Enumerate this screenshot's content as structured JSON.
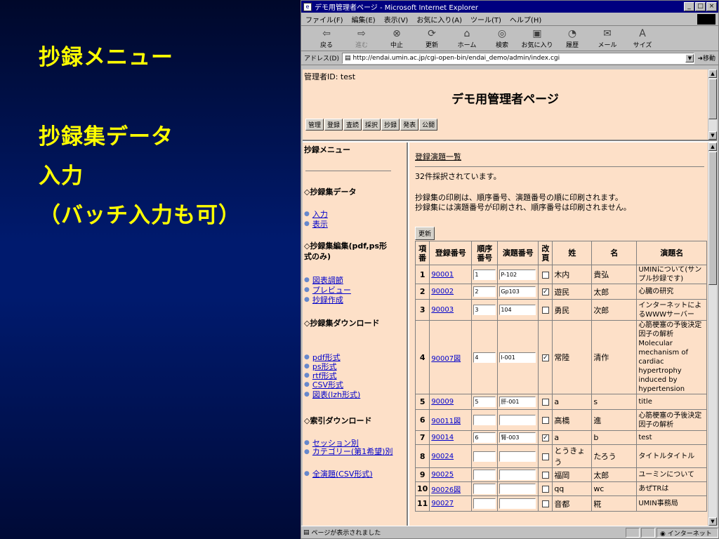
{
  "slide": {
    "heading": "抄録メニュー",
    "lines": [
      "抄録集データ",
      "入力",
      "（バッチ入力も可）"
    ]
  },
  "window": {
    "title": "デモ用管理者ページ - Microsoft Internet Explorer",
    "menu": [
      "ファイル(F)",
      "編集(E)",
      "表示(V)",
      "お気に入り(A)",
      "ツール(T)",
      "ヘルプ(H)"
    ],
    "toolbar": [
      {
        "label": "戻る",
        "icon": "back-arrow"
      },
      {
        "label": "進む",
        "icon": "forward-arrow"
      },
      {
        "label": "中止",
        "icon": "stop"
      },
      {
        "label": "更新",
        "icon": "refresh"
      },
      {
        "label": "ホーム",
        "icon": "home"
      },
      {
        "label": "検索",
        "icon": "search"
      },
      {
        "label": "お気に入り",
        "icon": "favorites"
      },
      {
        "label": "履歴",
        "icon": "history"
      },
      {
        "label": "メール",
        "icon": "mail"
      },
      {
        "label": "サイズ",
        "icon": "font-size"
      }
    ],
    "address_label": "アドレス(D)",
    "address": "http://endai.umin.ac.jp/cgi-open-bin/endai_demo/admin/index.cgi",
    "go": "移動",
    "status": "ページが表示されました",
    "zone": "インターネット"
  },
  "top_frame": {
    "admin_id": "管理者ID: test",
    "title": "デモ用管理者ページ",
    "nav": [
      "管理",
      "登録",
      "査読",
      "採択",
      "抄録",
      "発表",
      "公開"
    ]
  },
  "left_frame": {
    "title": "抄録メニュー",
    "sections": [
      {
        "title": "◇抄録集データ",
        "items": [
          "入力",
          "表示"
        ]
      },
      {
        "title": "◇抄録集編集(pdf,ps形式のみ)",
        "items": [
          "図表調節",
          "プレビュー",
          "抄録作成"
        ]
      },
      {
        "title": "◇抄録集ダウンロード",
        "items": [
          "pdf形式",
          "ps形式",
          "rtf形式",
          "CSV形式",
          "図表(lzh形式)"
        ]
      },
      {
        "title": "◇索引ダウンロード",
        "items": [
          "セッション別",
          "カテゴリー(第1希望)別",
          "全演題(CSV形式)"
        ]
      }
    ]
  },
  "main": {
    "title": "登録演題一覧",
    "count_text": "32件採択されています。",
    "note1": "抄録集の印刷は、順序番号、演題番号の順に印刷されます。",
    "note2": "抄録集には演題番号が印刷され、順序番号は印刷されません。",
    "update_button": "更新",
    "columns": [
      "項番",
      "登録番号",
      "順序番号",
      "演題番号",
      "改頁",
      "姓",
      "名",
      "演題名"
    ],
    "rows": [
      {
        "no": "1",
        "reg": "90001",
        "seq": "1",
        "num": "P-102",
        "pg": false,
        "sei": "木内",
        "mei": "貴弘",
        "title": "UMINについて(サンプル抄録です)"
      },
      {
        "no": "2",
        "reg": "90002",
        "seq": "2",
        "num": "Gp103",
        "pg": true,
        "sei": "遊民",
        "mei": "太郎",
        "title": "心臓の研究"
      },
      {
        "no": "3",
        "reg": "90003",
        "seq": "3",
        "num": "104",
        "pg": false,
        "sei": "勇民",
        "mei": "次郎",
        "title": "インターネットによるWWWサーバー"
      },
      {
        "no": "4",
        "reg": "90007図",
        "seq": "4",
        "num": "I-001",
        "pg": true,
        "sei": "常陸",
        "mei": "清作",
        "title": "心筋梗塞の予後決定因子の解析 Molecular mechanism of cardiac hypertrophy induced by hypertension"
      },
      {
        "no": "5",
        "reg": "90009",
        "seq": "5",
        "num": "肝-001",
        "pg": false,
        "sei": "a",
        "mei": "s",
        "title": "title"
      },
      {
        "no": "6",
        "reg": "90011図",
        "seq": "",
        "num": "",
        "pg": false,
        "sei": "高橋",
        "mei": "進",
        "title": "心筋梗塞の予後決定因子の解析"
      },
      {
        "no": "7",
        "reg": "90014",
        "seq": "6",
        "num": "腎-003",
        "pg": true,
        "sei": "a",
        "mei": "b",
        "title": "test"
      },
      {
        "no": "8",
        "reg": "90024",
        "seq": "",
        "num": "",
        "pg": false,
        "sei": "とうきょう",
        "mei": "たろう",
        "title": "タイトルタイトル"
      },
      {
        "no": "9",
        "reg": "90025",
        "seq": "",
        "num": "",
        "pg": false,
        "sei": "福岡",
        "mei": "太郎",
        "title": "ユーミンについて"
      },
      {
        "no": "10",
        "reg": "90026図",
        "seq": "",
        "num": "",
        "pg": false,
        "sei": "qq",
        "mei": "wc",
        "title": "あぜTRは"
      },
      {
        "no": "11",
        "reg": "90027",
        "seq": "",
        "num": "",
        "pg": false,
        "sei": "音都",
        "mei": "糀",
        "title": "UMIN事務局"
      }
    ]
  }
}
